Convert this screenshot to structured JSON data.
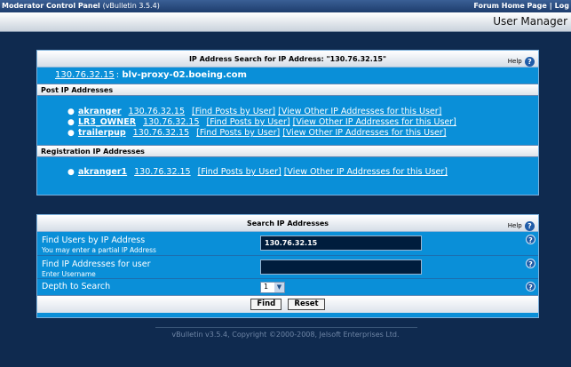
{
  "topbar": {
    "app_title": "Moderator Control Panel",
    "app_version": "(vBulletin 3.5.4)",
    "links": [
      "Forum Home Page",
      "|",
      "Log"
    ]
  },
  "header": {
    "title": "User Manager"
  },
  "ip_panel": {
    "title": "IP Address Search for IP Address: \"130.76.32.15\"",
    "help_label": "Help",
    "host_ip": "130.76.32.15",
    "host_sep": ":",
    "host_name": "blv-proxy-02.boeing.com",
    "post_section_title": "Post IP Addresses",
    "post_entries": [
      {
        "user": "akranger",
        "ip": "130.76.32.15",
        "find": "[Find Posts by User]",
        "other": "[View Other IP Addresses for this User]"
      },
      {
        "user": "LR3_OWNER",
        "ip": "130.76.32.15",
        "find": "[Find Posts by User]",
        "other": "[View Other IP Addresses for this User]"
      },
      {
        "user": "trailerpup",
        "ip": "130.76.32.15",
        "find": "[Find Posts by User]",
        "other": "[View Other IP Addresses for this User]"
      }
    ],
    "reg_section_title": "Registration IP Addresses",
    "reg_entries": [
      {
        "user": "akranger1",
        "ip": "130.76.32.15",
        "find": "[Find Posts by User]",
        "other": "[View Other IP Addresses for this User]"
      }
    ]
  },
  "search_panel": {
    "title": "Search IP Addresses",
    "help_label": "Help",
    "ip_label": "Find Users by IP Address",
    "ip_hint": "You may enter a partial IP Address",
    "ip_value": "130.76.32.15",
    "user_label": "Find IP Addresses for user",
    "user_hint": "Enter Username",
    "user_value": "",
    "depth_label": "Depth to Search",
    "depth_value": "1",
    "find_button": "Find",
    "reset_button": "Reset"
  },
  "footer": {
    "text": "vBulletin v3.5.4, Copyright ©2000-2008, Jelsoft Enterprises Ltd."
  },
  "colors": {
    "background": "#0f2a4f",
    "panel": "#0a8fd8",
    "help_icon": "#1f5ca8"
  },
  "icons": {
    "help": "question-mark-icon",
    "bullet": "bullet-icon",
    "dropdown": "chevron-down-icon"
  }
}
